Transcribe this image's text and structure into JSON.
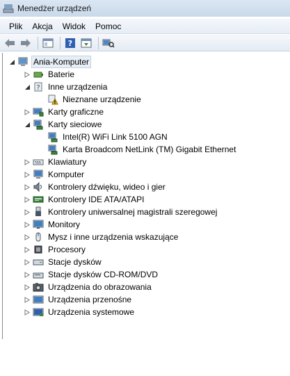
{
  "window": {
    "title": "Menedżer urządzeń"
  },
  "menu": {
    "items": [
      "Plik",
      "Akcja",
      "Widok",
      "Pomoc"
    ]
  },
  "toolbar": {
    "buttons": [
      "back-icon",
      "forward-icon",
      "properties-icon",
      "help-icon",
      "update-driver-icon",
      "scan-hardware-icon"
    ]
  },
  "tree": {
    "root": "Ania-Komputer",
    "items": [
      {
        "label": "Baterie",
        "icon": "battery-icon",
        "expanded": false
      },
      {
        "label": "Inne urządzenia",
        "icon": "unknown-device-icon",
        "expanded": true
      },
      {
        "label": "Nieznane urządzenie",
        "icon": "warning-device-icon",
        "child": true
      },
      {
        "label": "Karty graficzne",
        "icon": "display-adapter-icon",
        "expanded": false
      },
      {
        "label": "Karty sieciowe",
        "icon": "network-adapter-icon",
        "expanded": true
      },
      {
        "label": "Intel(R) WiFi Link 5100 AGN",
        "icon": "network-adapter-icon",
        "child": true
      },
      {
        "label": "Karta Broadcom NetLink (TM) Gigabit Ethernet",
        "icon": "network-adapter-icon",
        "child": true
      },
      {
        "label": "Klawiatury",
        "icon": "keyboard-icon",
        "expanded": false
      },
      {
        "label": "Komputer",
        "icon": "computer-icon",
        "expanded": false
      },
      {
        "label": "Kontrolery dźwięku, wideo i gier",
        "icon": "sound-icon",
        "expanded": false
      },
      {
        "label": "Kontrolery IDE ATA/ATAPI",
        "icon": "ide-controller-icon",
        "expanded": false
      },
      {
        "label": "Kontrolery uniwersalnej magistrali szeregowej",
        "icon": "usb-icon",
        "expanded": false
      },
      {
        "label": "Monitory",
        "icon": "monitor-icon",
        "expanded": false
      },
      {
        "label": "Mysz i inne urządzenia wskazujące",
        "icon": "mouse-icon",
        "expanded": false
      },
      {
        "label": "Procesory",
        "icon": "processor-icon",
        "expanded": false
      },
      {
        "label": "Stacje dysków",
        "icon": "disk-drive-icon",
        "expanded": false
      },
      {
        "label": "Stacje dysków CD-ROM/DVD",
        "icon": "cdrom-icon",
        "expanded": false
      },
      {
        "label": "Urządzenia do obrazowania",
        "icon": "camera-icon",
        "expanded": false
      },
      {
        "label": "Urządzenia przenośne",
        "icon": "portable-device-icon",
        "expanded": false
      },
      {
        "label": "Urządzenia systemowe",
        "icon": "system-device-icon",
        "expanded": false
      }
    ]
  }
}
